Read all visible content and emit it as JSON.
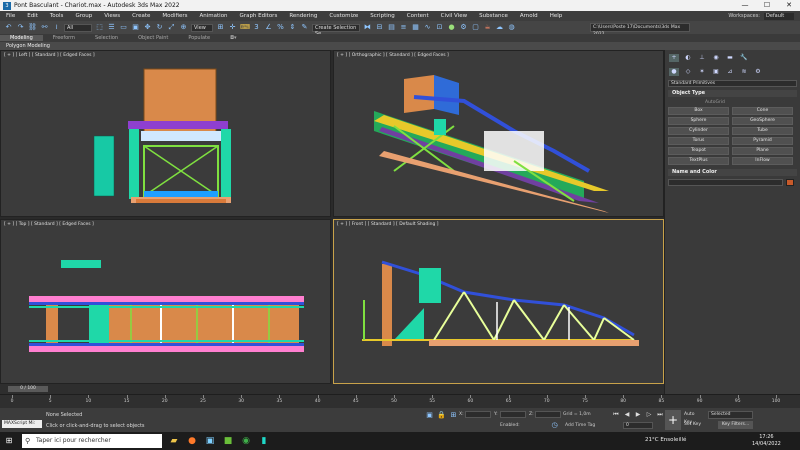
{
  "window": {
    "title": "Pont Basculant - Chariot.max - Autodesk 3ds Max 2022",
    "controls": [
      "—",
      "☐",
      "✕"
    ]
  },
  "menu": [
    "File",
    "Edit",
    "Tools",
    "Group",
    "Views",
    "Create",
    "Modifiers",
    "Animation",
    "Graph Editors",
    "Rendering",
    "Customize",
    "Scripting",
    "Content",
    "Civil View",
    "Substance",
    "Arnold",
    "Help"
  ],
  "workspaces": {
    "label": "Workspaces:",
    "value": "Default"
  },
  "toolbar": {
    "filter_value": "All",
    "view_value": "View",
    "selection_set": "Create Selection Se",
    "path": "C:\\Users\\Poste 17\\Documents\\3ds Max 2022"
  },
  "ribbon": {
    "tabs": [
      "Modeling",
      "Freeform",
      "Selection",
      "Object Paint",
      "Populate"
    ],
    "sub": "Polygon Modeling"
  },
  "viewports": {
    "top_left": "[ + ] [ Left ] [ Standard ] [ Edged Faces ]",
    "top_right": "[ + ] [ Orthographic ] [ Standard ] [ Edged Faces ]",
    "bottom_left": "[ + ] [ Top ] [ Standard ] [ Edged Faces ]",
    "bottom_right": "[ + ] [ Front ] [ Standard ] [ Default Shading ]"
  },
  "command_panel": {
    "category": "Standard Primitives",
    "object_type_title": "Object Type",
    "autogrid": "AutoGrid",
    "buttons": [
      "Box",
      "Cone",
      "Sphere",
      "GeoSphere",
      "Cylinder",
      "Tube",
      "Torus",
      "Pyramid",
      "Teapot",
      "Plane",
      "TextPlus",
      "InFlow"
    ],
    "name_color_title": "Name and Color",
    "color": "#c75a2a"
  },
  "timeline": {
    "slider": "0 / 100",
    "ticks": [
      "0",
      "5",
      "10",
      "15",
      "20",
      "25",
      "30",
      "35",
      "40",
      "45",
      "50",
      "55",
      "60",
      "65",
      "70",
      "75",
      "80",
      "85",
      "90",
      "95",
      "100"
    ]
  },
  "status": {
    "maxscript": "MAXScript Mi:",
    "selection": "None Selected",
    "prompt": "Click or click-and-drag to select objects",
    "x_label": "X:",
    "y_label": "Y:",
    "z_label": "Z:",
    "grid": "Grid = 1,0m",
    "enabled": "Enabled:",
    "add_time_tag": "Add Time Tag",
    "frame": "0",
    "auto_key": "Auto Key",
    "set_key": "Set Key",
    "selected": "Selected",
    "key_filters": "Key Filters..."
  },
  "taskbar": {
    "search_placeholder": "Taper ici pour rechercher",
    "weather": "21°C  Ensoleillé",
    "time": "17:26",
    "date": "14/04/2022"
  }
}
